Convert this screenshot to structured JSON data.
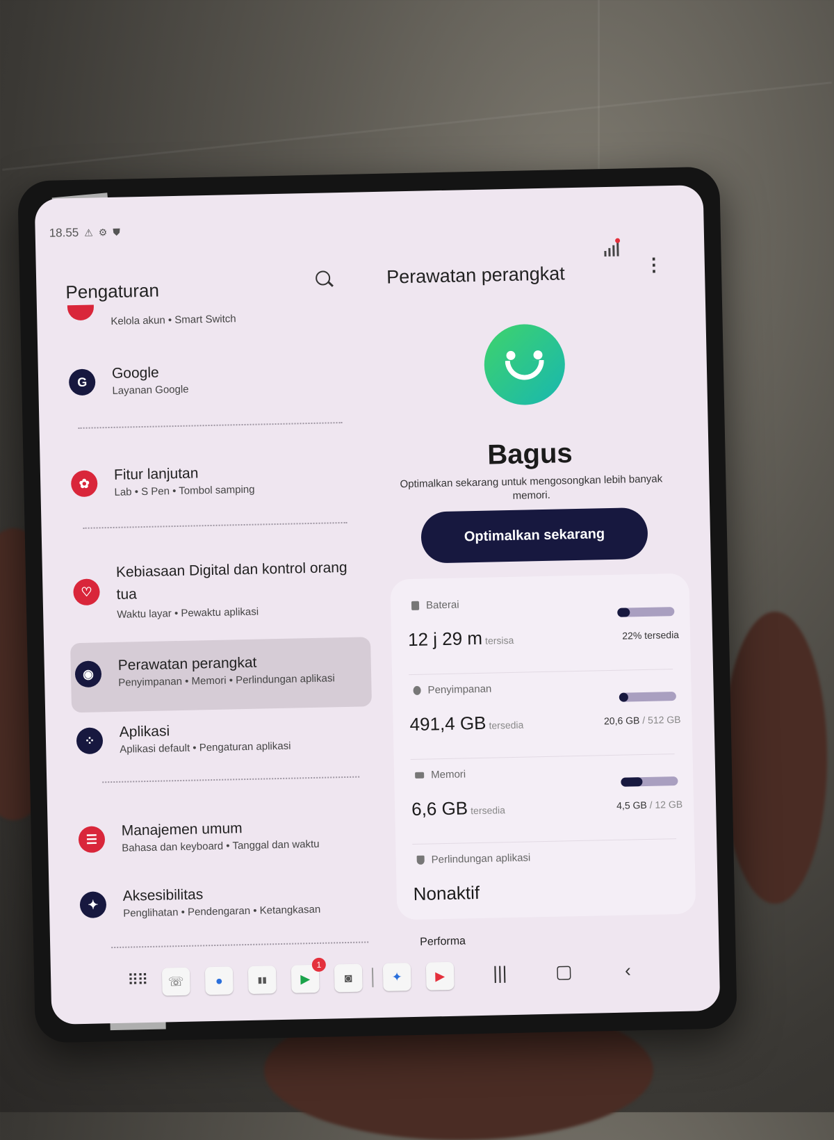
{
  "status_bar": {
    "time": "18.55"
  },
  "settings_pane": {
    "title": "Pengaturan",
    "partial_item_subtitle": "Kelola akun  •  Smart Switch",
    "items": [
      {
        "glyph": "G",
        "title": "Google",
        "subtitle": "Layanan Google",
        "color": "#17183f"
      },
      {
        "glyph": "✿",
        "title": "Fitur lanjutan",
        "subtitle": "Lab  •  S Pen  •  Tombol samping",
        "color": "#d9263a"
      },
      {
        "glyph": "♡",
        "title": "Kebiasaan Digital dan kontrol orang",
        "title2": "tua",
        "subtitle": "Waktu layar  •  Pewaktu aplikasi",
        "color": "#d9263a"
      },
      {
        "glyph": "◉",
        "title": "Perawatan perangkat",
        "subtitle": "Penyimpanan  •  Memori  •  Perlindungan aplikasi",
        "color": "#17183f"
      },
      {
        "glyph": "⁘",
        "title": "Aplikasi",
        "subtitle": "Aplikasi default  •  Pengaturan aplikasi",
        "color": "#17183f"
      },
      {
        "glyph": "☰",
        "title": "Manajemen umum",
        "subtitle": "Bahasa dan keyboard  •  Tanggal dan waktu",
        "color": "#d9263a"
      },
      {
        "glyph": "✦",
        "title": "Aksesibilitas",
        "subtitle": "Penglihatan  •  Pendengaran  •  Ketangkasan",
        "color": "#17183f"
      }
    ]
  },
  "device_care": {
    "title": "Perawatan perangkat",
    "status_word": "Bagus",
    "description": "Optimalkan sekarang untuk mengosongkan lebih banyak memori.",
    "button_label": "Optimalkan sekarang",
    "battery": {
      "label": "Baterai",
      "value": "12 j 29 m",
      "suffix": "tersisa",
      "right": "22% tersedia",
      "level": 0.22
    },
    "storage": {
      "label": "Penyimpanan",
      "value": "491,4 GB",
      "suffix": "tersedia",
      "used": "20,6 GB",
      "total": "/ 512 GB",
      "level": 0.04
    },
    "memory": {
      "label": "Memori",
      "value": "6,6 GB",
      "suffix": "tersedia",
      "used": "4,5 GB",
      "total": "/ 12 GB",
      "level": 0.375
    },
    "protection": {
      "label": "Perlindungan aplikasi",
      "value": "Nonaktif"
    },
    "performance_label": "Performa"
  },
  "taskbar": {
    "play_badge": "1"
  },
  "colors": {
    "accent_dark": "#17183f",
    "accent_red": "#d9263a",
    "smiley_start": "#3fd36b",
    "smiley_end": "#18b7b0"
  },
  "icons": [
    "search-icon",
    "stats-icon",
    "more-options-icon",
    "smiley-icon",
    "app-drawer-icon",
    "recents-icon",
    "home-icon",
    "back-icon"
  ]
}
